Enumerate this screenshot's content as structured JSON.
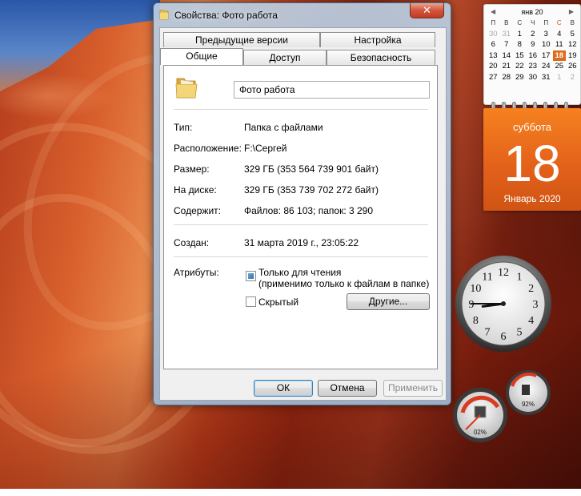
{
  "window": {
    "title": "Свойства: Фото работа",
    "close_label": "✕"
  },
  "tabs": {
    "row_back": [
      "Предыдущие версии",
      "Настройка"
    ],
    "row_front": [
      "Общие",
      "Доступ",
      "Безопасность"
    ],
    "active": "Общие"
  },
  "general": {
    "name": "Фото работа",
    "fields": [
      {
        "label": "Тип:",
        "value": "Папка с файлами"
      },
      {
        "label": "Расположение:",
        "value": "F:\\Сергей"
      },
      {
        "label": "Размер:",
        "value": "329 ГБ (353 564 739 901 байт)"
      },
      {
        "label": "На диске:",
        "value": "329 ГБ (353 739 702 272 байт)"
      },
      {
        "label": "Содержит:",
        "value": "Файлов: 86 103; папок: 3 290"
      }
    ],
    "created_label": "Создан:",
    "created_value": "31 марта 2019 г., 23:05:22",
    "attributes_label": "Атрибуты:",
    "readonly_line1": "Только для чтения",
    "readonly_line2": "(применимо только к файлам в папке)",
    "hidden_label": "Скрытый",
    "other_button": "Другие..."
  },
  "buttons": {
    "ok": "ОК",
    "cancel": "Отмена",
    "apply": "Применить"
  },
  "calendar": {
    "month_short": "янв 20",
    "headers": [
      "П",
      "В",
      "С",
      "Ч",
      "П",
      "С",
      "В"
    ],
    "weeks": [
      [
        "30",
        "31",
        "1",
        "2",
        "3",
        "4",
        "5"
      ],
      [
        "6",
        "7",
        "8",
        "9",
        "10",
        "11",
        "12"
      ],
      [
        "13",
        "14",
        "15",
        "16",
        "17",
        "18",
        "19"
      ],
      [
        "20",
        "21",
        "22",
        "23",
        "24",
        "25",
        "26"
      ],
      [
        "27",
        "28",
        "29",
        "30",
        "31",
        "1",
        "2"
      ]
    ],
    "today": "18",
    "weekday": "суббота",
    "day": "18",
    "month_year": "Январь 2020"
  },
  "clock": {
    "numbers": [
      "12",
      "1",
      "2",
      "3",
      "4",
      "5",
      "6",
      "7",
      "8",
      "9",
      "10",
      "11"
    ],
    "hour": 8,
    "minute": 45
  },
  "meter": {
    "cpu_label": "02%",
    "mem_label": "92%",
    "cpu_value": 2,
    "mem_value": 92
  },
  "colors": {
    "accent_orange": "#e2601a",
    "check_fill": "#2f6fa8"
  }
}
